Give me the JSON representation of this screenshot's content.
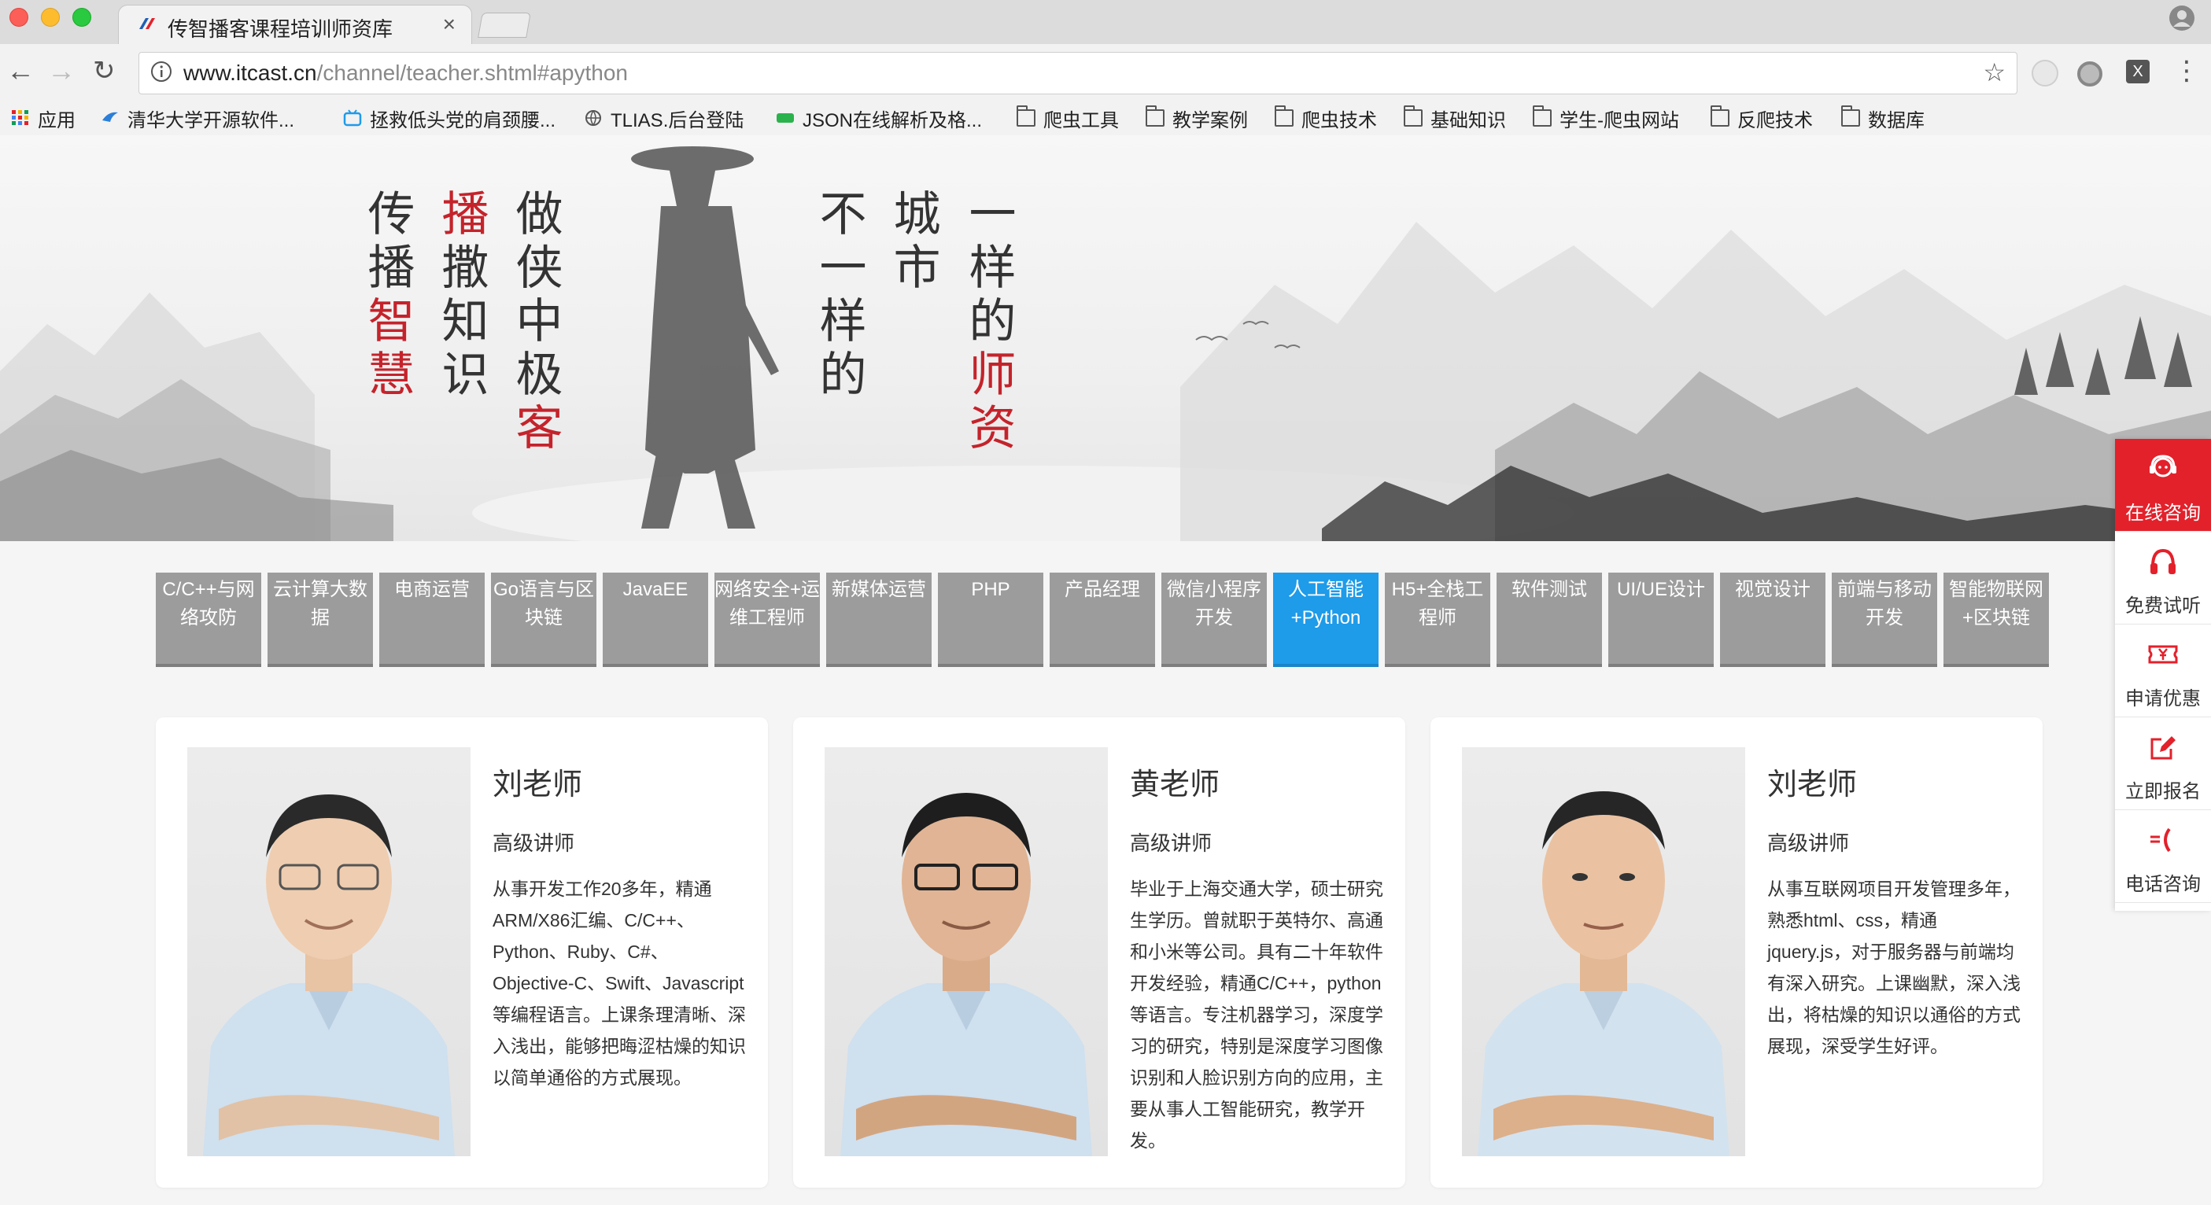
{
  "browser": {
    "tab_title": "传智播客课程培训师资库",
    "tab_close": "×",
    "url_host": "www.itcast.cn",
    "url_path": "/channel/teacher.shtml#apython",
    "back": "←",
    "forward": "→",
    "reload": "↻",
    "star": "☆",
    "menu": "⋮",
    "ext3": "X",
    "bookmarks": [
      {
        "label": "应用",
        "icon": "apps-grid-icon"
      },
      {
        "label": "清华大学开源软件...",
        "icon": "bird-icon"
      },
      {
        "label": "拯救低头党的肩颈腰...",
        "icon": "bilibili-icon"
      },
      {
        "label": "TLIAS.后台登陆",
        "icon": "globe-icon"
      },
      {
        "label": "JSON在线解析及格...",
        "icon": "json-icon"
      },
      {
        "label": "爬虫工具",
        "icon": "folder-icon"
      },
      {
        "label": "教学案例",
        "icon": "folder-icon"
      },
      {
        "label": "爬虫技术",
        "icon": "folder-icon"
      },
      {
        "label": "基础知识",
        "icon": "folder-icon"
      },
      {
        "label": "学生-爬虫网站",
        "icon": "folder-icon"
      },
      {
        "label": "反爬技术",
        "icon": "folder-icon"
      },
      {
        "label": "数据库",
        "icon": "folder-icon"
      }
    ]
  },
  "banner": {
    "col1_top": "传播",
    "col1_red": "智慧",
    "col2_red": "播",
    "col2_rest": "撒知识",
    "col3_black": "做侠中极",
    "col3_red": "客",
    "col4": "不一样的",
    "col5": "城市",
    "col6_black": "一样的",
    "col6_red": "师资"
  },
  "categories": [
    {
      "label": "C/C++与网络攻防"
    },
    {
      "label": "云计算大数据"
    },
    {
      "label": "电商运营"
    },
    {
      "label": "Go语言与区块链"
    },
    {
      "label": "JavaEE"
    },
    {
      "label": "网络安全+运维工程师"
    },
    {
      "label": "新媒体运营"
    },
    {
      "label": "PHP"
    },
    {
      "label": "产品经理"
    },
    {
      "label": "微信小程序开发"
    },
    {
      "label": "人工智能+Python"
    },
    {
      "label": "H5+全栈工程师"
    },
    {
      "label": "软件测试"
    },
    {
      "label": "UI/UE设计"
    },
    {
      "label": "视觉设计"
    },
    {
      "label": "前端与移动开发"
    },
    {
      "label": "智能物联网+区块链"
    }
  ],
  "active_category": "人工智能+Python",
  "teachers": [
    {
      "name": "刘老师",
      "title": "高级讲师",
      "desc": "从事开发工作20多年，精通ARM/X86汇编、C/C++、Python、Ruby、C#、Objective-C、Swift、Javascript等编程语言。上课条理清晰、深入浅出，能够把晦涩枯燥的知识以简单通俗的方式展现。"
    },
    {
      "name": "黄老师",
      "title": "高级讲师",
      "desc": "毕业于上海交通大学，硕士研究生学历。曾就职于英特尔、高通和小米等公司。具有二十年软件开发经验，精通C/C++，python等语言。专注机器学习，深度学习的研究，特别是深度学习图像识别和人脸识别方向的应用，主要从事人工智能研究，教学开发。"
    },
    {
      "name": "刘老师",
      "title": "高级讲师",
      "desc": "从事互联网项目开发管理多年，熟悉html、css，精通jquery.js，对于服务器与前端均有深入研究。上课幽默，深入浅出，将枯燥的知识以通俗的方式展现，深受学生好评。"
    }
  ],
  "sidebar": [
    {
      "label": "在线咨询",
      "icon": "customer-service-icon"
    },
    {
      "label": "免费试听",
      "icon": "headphones-icon"
    },
    {
      "label": "申请优惠",
      "icon": "coupon-icon"
    },
    {
      "label": "立即报名",
      "icon": "edit-icon"
    },
    {
      "label": "电话咨询",
      "icon": "phone-icon"
    }
  ],
  "colors": {
    "active_tab": "#1e9be9",
    "inactive_tab": "#9c9c9c",
    "accent_red": "#e3212b",
    "banner_red": "#c4232b"
  }
}
